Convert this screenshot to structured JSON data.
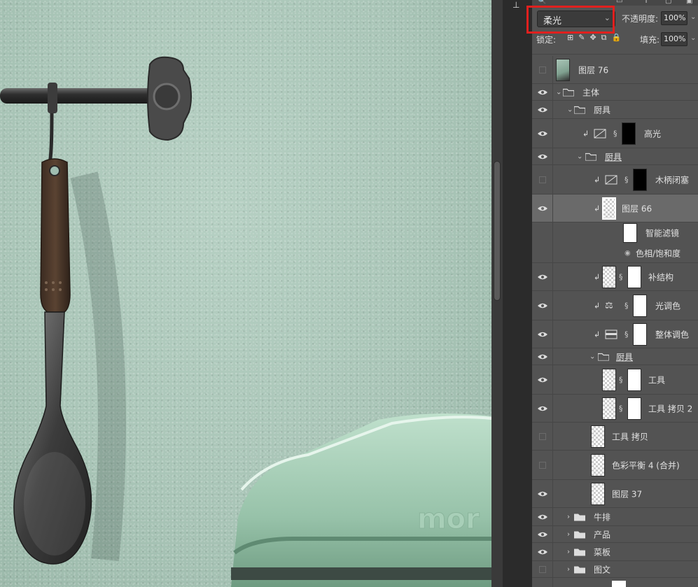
{
  "options": {
    "blend_mode": "柔光",
    "opacity_label": "不透明度:",
    "opacity_value": "100%",
    "lock_label": "锁定:",
    "fill_label": "填充:",
    "fill_value": "100%"
  },
  "layers": [
    {
      "name": "图层 76"
    },
    {
      "name": "主体"
    },
    {
      "name": "厨具"
    },
    {
      "name": "高光"
    },
    {
      "name": "厨具"
    },
    {
      "name": "木柄闭塞"
    },
    {
      "name": "图层 66"
    },
    {
      "name": "智能滤镜"
    },
    {
      "name": "色相/饱和度"
    },
    {
      "name": "补结构"
    },
    {
      "name": "光调色"
    },
    {
      "name": "整体调色"
    },
    {
      "name": "厨具"
    },
    {
      "name": "工具"
    },
    {
      "name": "工具 拷贝 2"
    },
    {
      "name": "工具 拷贝"
    },
    {
      "name": "色彩平衡 4 (合并)"
    },
    {
      "name": "图层 37"
    },
    {
      "name": "牛排"
    },
    {
      "name": "产品"
    },
    {
      "name": "菜板"
    },
    {
      "name": "图文"
    }
  ],
  "canvas": {
    "embossed_text": "mor"
  },
  "colors": {
    "panel_bg": "#535353",
    "selected_row": "#6a6a6a",
    "highlight": "#e0201e",
    "wall": "#a9c5b7"
  }
}
